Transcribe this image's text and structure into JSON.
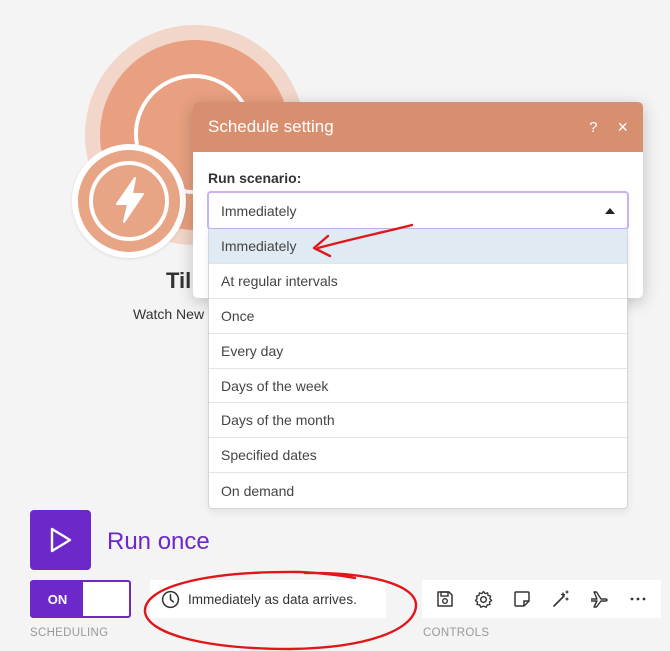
{
  "module": {
    "title": "Til",
    "subtitle": "Watch New"
  },
  "dialog": {
    "title": "Schedule setting",
    "help": "?",
    "close": "×",
    "field_label": "Run scenario:",
    "selected": "Immediately",
    "options": [
      "Immediately",
      "At regular intervals",
      "Once",
      "Every day",
      "Days of the week",
      "Days of the month",
      "Specified dates",
      "On demand"
    ]
  },
  "run_once": {
    "label": "Run once"
  },
  "scheduling": {
    "toggle_label": "ON",
    "summary": "Immediately as data arrives.",
    "caption": "SCHEDULING"
  },
  "controls": {
    "caption": "CONTROLS",
    "icons": [
      "save-icon",
      "gear-icon",
      "notes-icon",
      "magic-wand-icon",
      "airplane-icon",
      "more-icon"
    ]
  },
  "colors": {
    "accent": "#6d28c9",
    "module": "#e8a080",
    "dialog_header": "#d88f6f",
    "annotation": "#e0161b"
  }
}
